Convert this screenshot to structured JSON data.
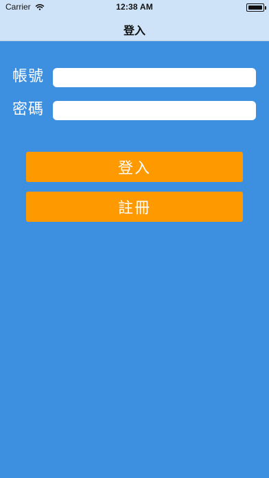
{
  "status_bar": {
    "carrier": "Carrier",
    "time": "12:38 AM",
    "battery_level_percent": 100,
    "icons": [
      "wifi-icon",
      "battery-icon"
    ]
  },
  "navigation": {
    "title": "登入"
  },
  "form": {
    "account_label": "帳號",
    "account_value": "",
    "password_label": "密碼",
    "password_value": ""
  },
  "actions": {
    "login_label": "登入",
    "register_label": "註冊"
  },
  "colors": {
    "background": "#3d8fe0",
    "topbar": "#cfe3f8",
    "button": "#ff9900",
    "text_light": "#ffffff",
    "text_dark": "#111111"
  }
}
